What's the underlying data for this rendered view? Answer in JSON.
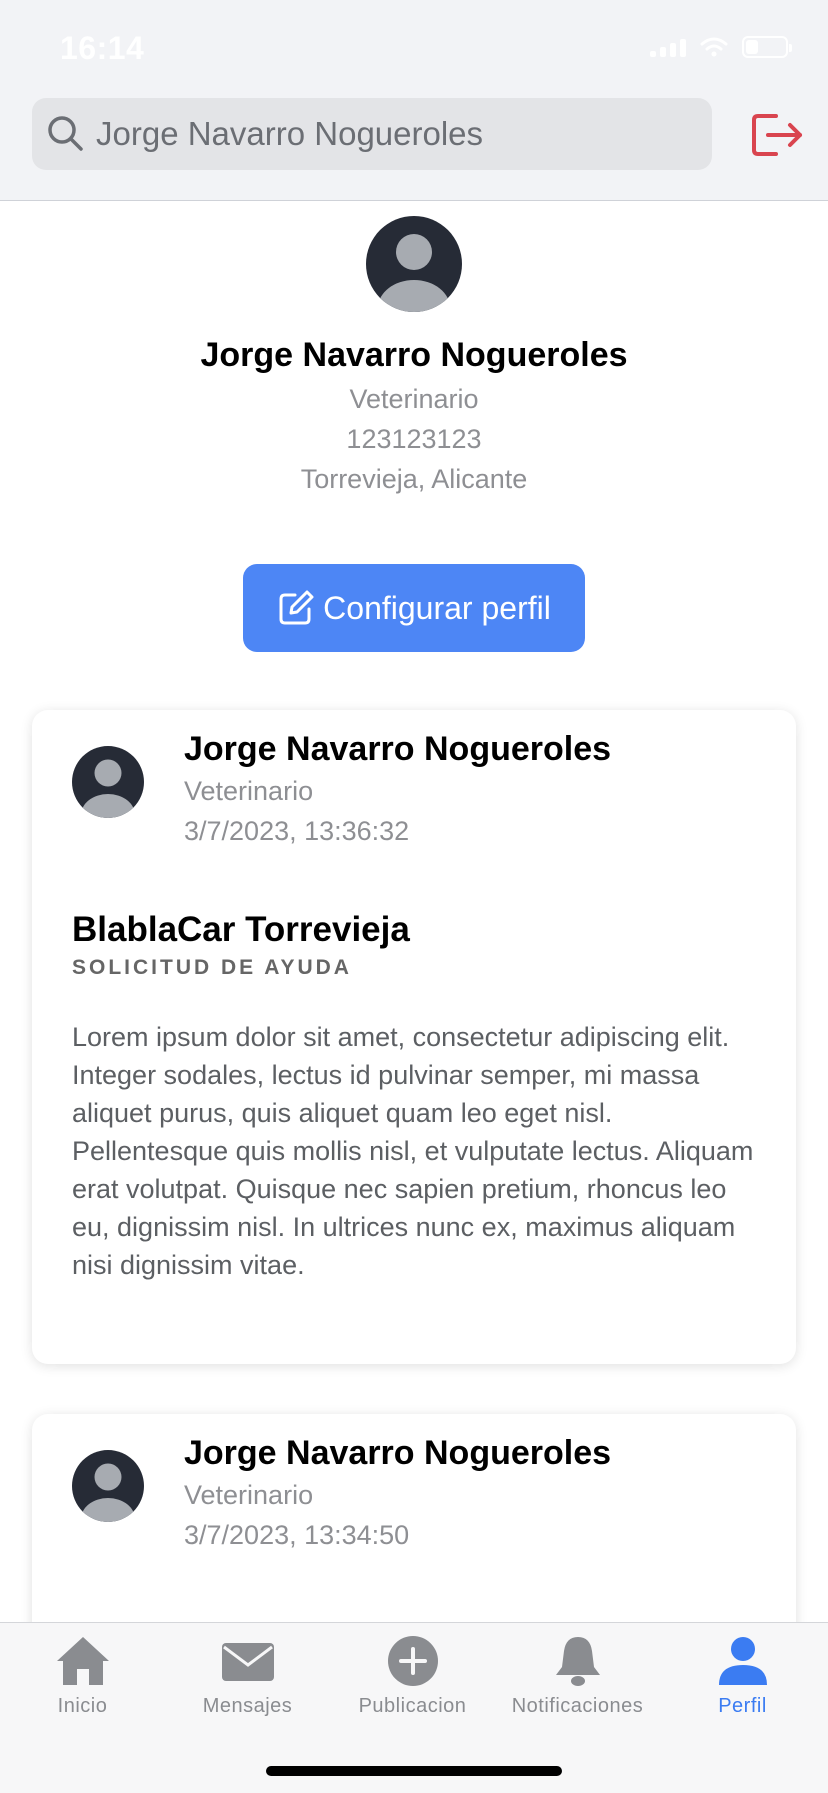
{
  "status_bar": {
    "time": "16:14"
  },
  "header": {
    "search_value": "Jorge Navarro Nogueroles"
  },
  "profile": {
    "name": "Jorge Navarro Nogueroles",
    "role": "Veterinario",
    "phone": "123123123",
    "location": "Torrevieja, Alicante",
    "config_button_label": "Configurar perfil"
  },
  "posts": [
    {
      "author": "Jorge Navarro Nogueroles",
      "role": "Veterinario",
      "date": "3/7/2023, 13:36:32",
      "title": "BlablaCar Torrevieja",
      "category": "SOLICITUD DE AYUDA",
      "body": "Lorem ipsum dolor sit amet, consectetur adipiscing elit. Integer sodales, lectus id pulvinar semper, mi massa aliquet purus, quis aliquet quam leo eget nisl. Pellentesque quis mollis nisl, et vulputate lectus. Aliquam erat volutpat. Quisque nec sapien pretium, rhoncus leo eu, dignissim nisl. In ultrices nunc ex, maximus aliquam nisi dignissim vitae."
    },
    {
      "author": "Jorge Navarro Nogueroles",
      "role": "Veterinario",
      "date": "3/7/2023, 13:34:50"
    }
  ],
  "tabbar": {
    "items": [
      {
        "label": "Inicio",
        "icon": "home-icon"
      },
      {
        "label": "Mensajes",
        "icon": "mail-icon"
      },
      {
        "label": "Publicacion",
        "icon": "plus-circle-icon"
      },
      {
        "label": "Notificaciones",
        "icon": "bell-icon"
      },
      {
        "label": "Perfil",
        "icon": "person-icon",
        "active": true
      }
    ]
  },
  "colors": {
    "accent": "#4d86f5",
    "logout": "#d9444f",
    "avatar_bg": "#262b36",
    "avatar_fg": "#a7abb1"
  }
}
